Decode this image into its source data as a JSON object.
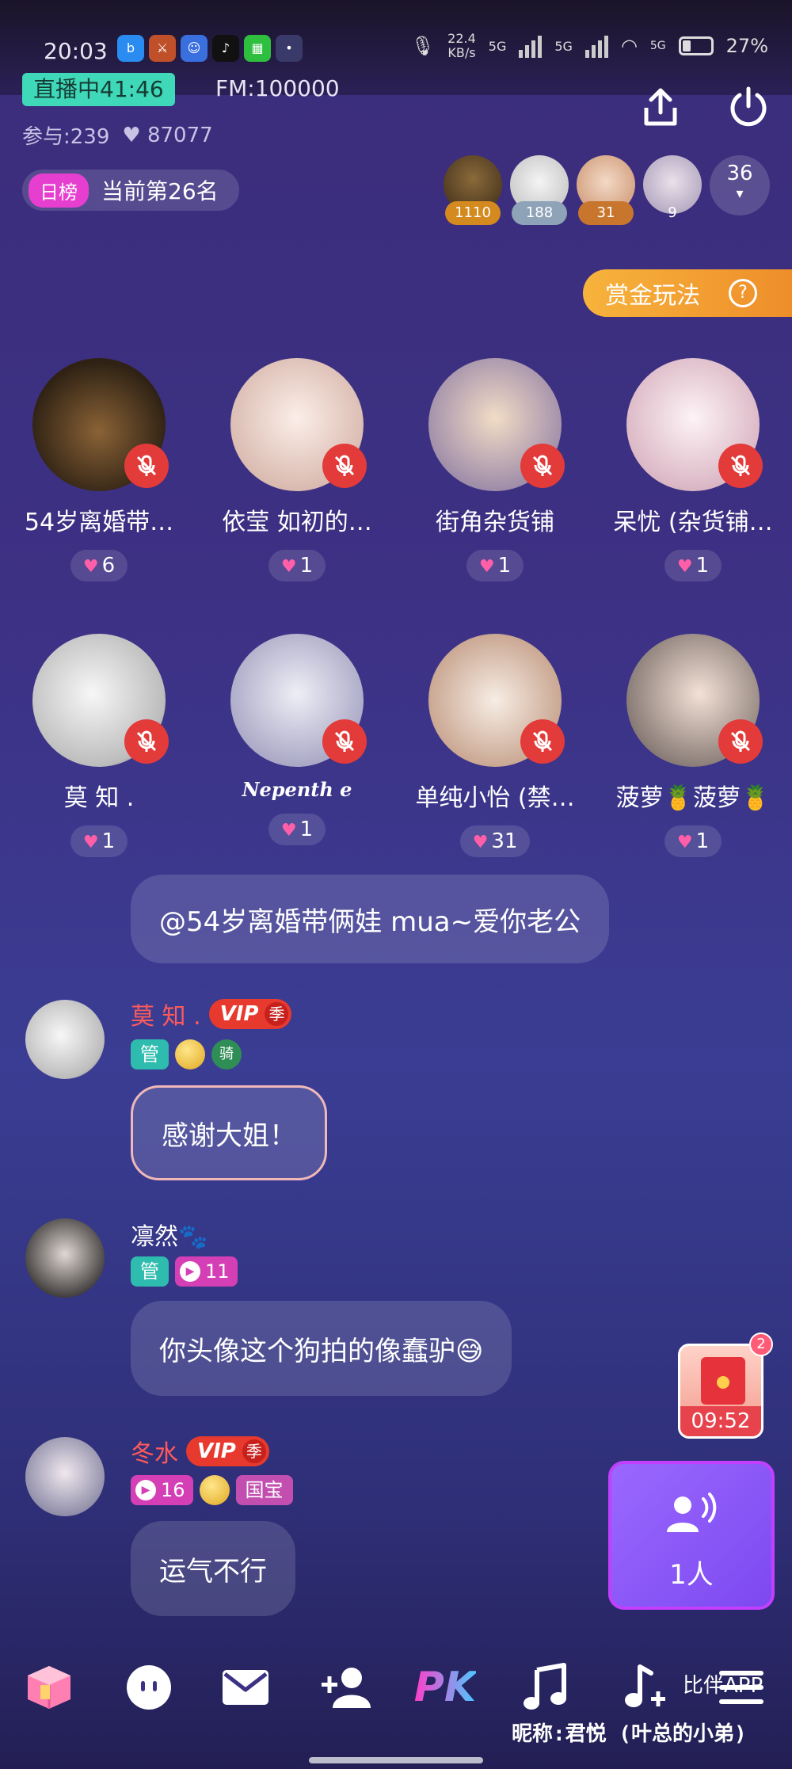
{
  "status_bar": {
    "time": "20:03",
    "net_speed_value": "22.4",
    "net_speed_unit": "KB/s",
    "sim1": "5G",
    "sim2": "5G",
    "wifi_tag": "5G",
    "battery": "27%"
  },
  "room": {
    "live_label": "直播中41:46",
    "fm_id": "FM:100000",
    "participants": "参与:239",
    "hearts": "87077",
    "rank_tag": "日榜",
    "rank_text": "当前第26名",
    "audience": [
      {
        "count": "1110",
        "color": "#d48a1e"
      },
      {
        "count": "188",
        "color": "#8fa3b8"
      },
      {
        "count": "31",
        "color": "#c8762e"
      },
      {
        "count": "9",
        "color": "transparent"
      }
    ],
    "audience_more": "36",
    "bounty_label": "赏金玩法",
    "bounty_help": "?"
  },
  "seats": [
    {
      "name": "54岁离婚带…",
      "likes": "6"
    },
    {
      "name": "依莹 如初的…",
      "likes": "1"
    },
    {
      "name": "街角杂货铺",
      "likes": "1"
    },
    {
      "name": "呆忧 (杂货铺…",
      "likes": "1"
    },
    {
      "name": "莫 知 .",
      "likes": "1"
    },
    {
      "name": "Nepenth e",
      "likes": "1"
    },
    {
      "name": "单纯小怡 (禁…",
      "likes": "31"
    },
    {
      "name": "菠萝🍍菠萝🍍",
      "likes": "1"
    }
  ],
  "chat": {
    "system_msg": "@54岁离婚带俩娃 mua~爱你老公",
    "messages": [
      {
        "name": "莫 知 .",
        "name_color": "#ff5a5a",
        "vip": "VIP",
        "vip_season": "季",
        "badge_guan": "管",
        "badge_ride": "骑",
        "text": "感谢大姐！"
      },
      {
        "name": "凛然🐾",
        "name_color": "#ffffff",
        "badge_guan": "管",
        "level": "11",
        "text": "你头像这个狗拍的像蠢驴😅"
      },
      {
        "name": "冬水",
        "name_color": "#ff5a5a",
        "vip": "VIP",
        "vip_season": "季",
        "level": "16",
        "badge_guobao": "国宝",
        "text": "运气不行"
      }
    ]
  },
  "widgets": {
    "gift_timer": "09:52",
    "gift_badge": "2",
    "queue_count": "1人"
  },
  "bottom_bar": {
    "pk_label": "PK",
    "bi_tag": "比伴APP",
    "nickname": "昵称:君悦 (叶总的小弟)"
  }
}
